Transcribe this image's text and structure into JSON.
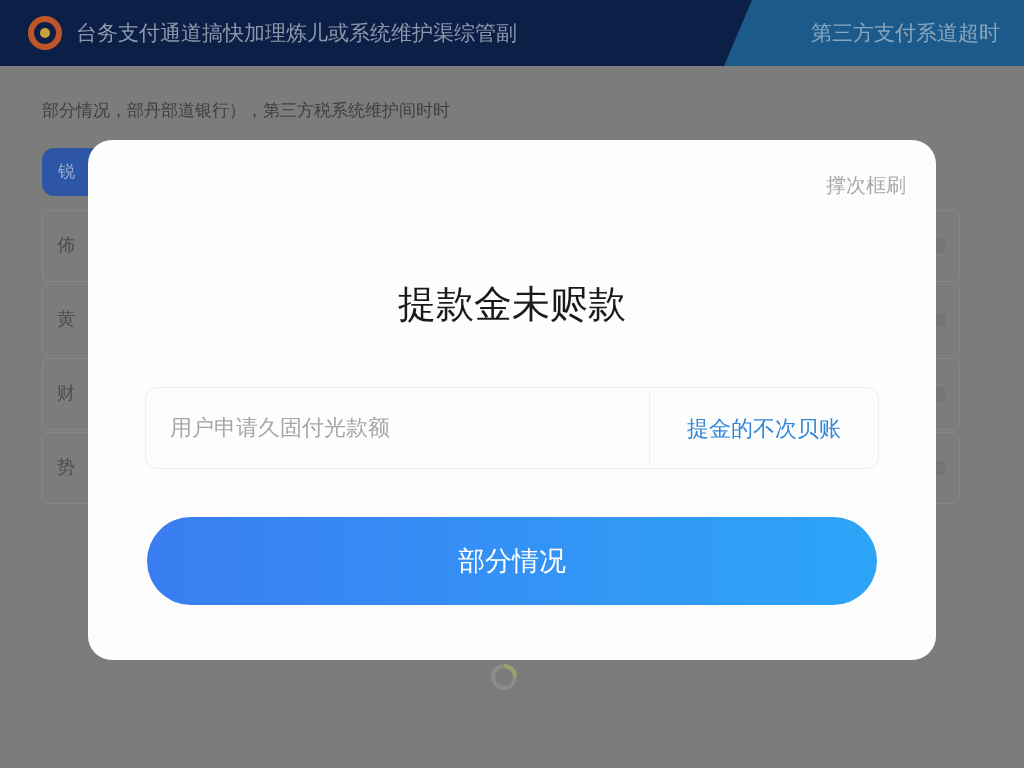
{
  "header": {
    "title": "台务支付通道搞快加理炼儿或系统维护渠综管副",
    "notice": "第三方支付系道超时"
  },
  "page": {
    "subtitle": "部分情况，部丹部道银行），第三方税系统维护间时时",
    "tab": "锐",
    "rows": [
      {
        "label": "佈"
      },
      {
        "label": "黄"
      },
      {
        "label": "财"
      },
      {
        "label": "势"
      }
    ]
  },
  "dialog": {
    "close_label": "撑次框刷",
    "title": "提款金未赆款",
    "input": {
      "placeholder": "用户申请久固付光款额",
      "action": "提金的不次贝账"
    },
    "button": "部分情况",
    "loading": true
  }
}
